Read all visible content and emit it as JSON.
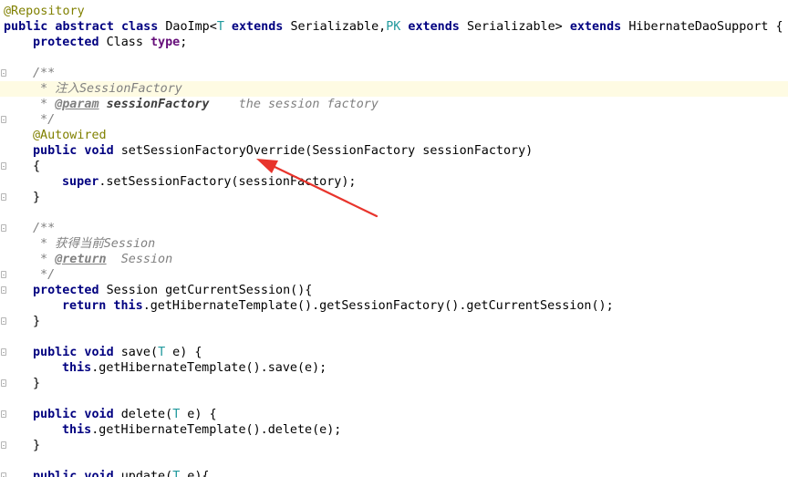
{
  "code": {
    "annotation_repository": "@Repository",
    "class_decl": {
      "kw1": "public abstract class ",
      "name": "DaoImp<",
      "t1": "T",
      "kw_ext1": " extends ",
      "ser1": "Serializable,",
      "pk": "PK",
      "kw_ext2": " extends ",
      "ser2": "Serializable> ",
      "kw_ext3": "extends ",
      "parent": "HibernateDaoSupport {"
    },
    "field": {
      "kw": "protected ",
      "type": "Class ",
      "name": "type",
      "end": ";"
    },
    "doc1": {
      "open": "/**",
      "line1": " * 注入SessionFactory",
      "line2_star": " * ",
      "param_tag": "@param",
      "param_name": " sessionFactory",
      "param_desc": "    the session factory",
      "close": " */"
    },
    "autowired": "@Autowired",
    "method_set": {
      "kw": "public void ",
      "rest": "setSessionFactoryOverride(SessionFactory sessionFactory)"
    },
    "open_brace": "{",
    "super_call": {
      "kw": "super",
      "rest": ".setSessionFactory(sessionFactory);"
    },
    "close_brace": "}",
    "doc2": {
      "open": "/**",
      "line1": " * 获得当前Session",
      "line2_star": " * ",
      "return_tag": "@return",
      "return_desc": "  Session",
      "close": " */"
    },
    "method_current": {
      "kw": "protected ",
      "rest": "Session getCurrentSession(){"
    },
    "return_stmt": {
      "kw": "return this",
      "rest": ".getHibernateTemplate().getSessionFactory().getCurrentSession();"
    },
    "method_save": {
      "kw": "public void ",
      "name": "save(",
      "t": "T",
      "rest": " e) {"
    },
    "save_body": {
      "kw": "this",
      "rest": ".getHibernateTemplate().save(e);"
    },
    "method_delete": {
      "kw": "public void ",
      "name": "delete(",
      "t": "T",
      "rest": " e) {"
    },
    "delete_body": {
      "kw": "this",
      "rest": ".getHibernateTemplate().delete(e);"
    },
    "method_update": {
      "kw": "public void ",
      "name": "update(",
      "t": "T",
      "rest": " e){"
    }
  },
  "colors": {
    "keyword": "#000080",
    "annotation": "#808000",
    "type_param": "#20999d",
    "comment": "#808080",
    "arrow": "#e8342c",
    "current_line": "#fefbe3"
  }
}
